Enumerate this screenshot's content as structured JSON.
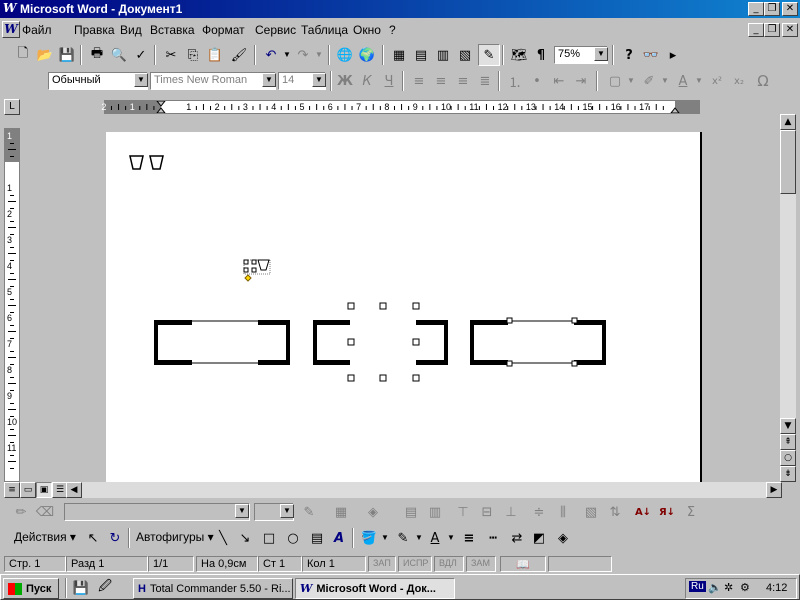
{
  "window": {
    "title": "Microsoft Word - Документ1",
    "controls": [
      "_",
      "❐",
      "✕"
    ],
    "doc_controls": [
      "_",
      "❐",
      "✕"
    ]
  },
  "menu": {
    "items": [
      "Файл",
      "Правка",
      "Вид",
      "Вставка",
      "Формат",
      "Сервис",
      "Таблица",
      "Окно",
      "?"
    ]
  },
  "standard_toolbar": {
    "zoom": "75%"
  },
  "format_toolbar": {
    "style": "Обычный",
    "font": "Times New Roman",
    "size": "14",
    "bold": "Ж",
    "italic": "К",
    "underline": "Ч",
    "omega": "Ω"
  },
  "ruler": {
    "corner": "L",
    "h_labels": [
      "2",
      "1",
      "1",
      "2",
      "3",
      "4",
      "5",
      "6",
      "7",
      "8",
      "9",
      "10",
      "11",
      "12",
      "13",
      "14",
      "15",
      "16",
      "17"
    ],
    "v_labels": [
      "1",
      "1",
      "2",
      "3",
      "4",
      "5",
      "6",
      "7",
      "8",
      "9",
      "10",
      "11"
    ]
  },
  "drawing_toolbar": {
    "actions": "Действия",
    "autoshapes": "Автофигуры"
  },
  "status": {
    "page": "Стр. 1",
    "section": "Разд 1",
    "pages": "1/1",
    "at": "На 0,9см",
    "line": "Ст 1",
    "col": "Кол 1",
    "rec": "ЗАП",
    "trk": "ИСПР",
    "ext": "ВДЛ",
    "ovr": "ЗАМ"
  },
  "taskbar": {
    "start": "Пуск",
    "tasks": [
      "Total Commander 5.50 - Ri...",
      "Microsoft Word - Док..."
    ],
    "lang": "Ru",
    "time": "4:12"
  }
}
